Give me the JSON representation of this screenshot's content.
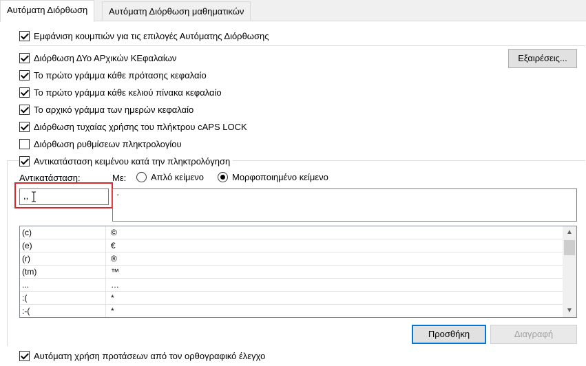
{
  "tabs": [
    {
      "label": "Αυτόματη Διόρθωση",
      "active": true
    },
    {
      "label": "Αυτόματη Διόρθωση μαθηματικών",
      "active": false
    }
  ],
  "options": {
    "show_buttons": {
      "label": "Εμφάνιση κουμπιών για τις επιλογές Αυτόματης Διόρθωσης",
      "checked": true
    },
    "two_initial_caps": {
      "label": "Διόρθωση ΔΥο ΑΡχικών ΚΕφαλαίων",
      "checked": true
    },
    "first_letter_sentence": {
      "label": "Το πρώτο γράμμα κάθε πρότασης κεφαλαίο",
      "checked": true
    },
    "first_letter_table_cell": {
      "label": "Το πρώτο γράμμα κάθε κελιού πίνακα κεφαλαίο",
      "checked": true
    },
    "day_names": {
      "label": "Το αρχικό γράμμα των ημερών κεφαλαίο",
      "checked": true
    },
    "caps_lock": {
      "label": "Διόρθωση τυχαίας χρήσης του πλήκτρου cAPS LOCK",
      "checked": true
    },
    "keyboard_settings": {
      "label": "Διόρθωση ρυθμίσεων πληκτρολογίου",
      "checked": false
    },
    "replace_text": {
      "label": "Αντικατάσταση κειμένου κατά την πληκτρολόγηση",
      "checked": true
    },
    "spellcheck_suggestions": {
      "label": "Αυτόματη χρήση προτάσεων από τον ορθογραφικό έλεγχο",
      "checked": true
    }
  },
  "buttons": {
    "exceptions": "Εξαιρέσεις...",
    "add": "Προσθήκη",
    "delete": "Διαγραφή"
  },
  "replace": {
    "replace_label": "Αντικατάσταση:",
    "with_label": "Με:",
    "plain_text": "Απλό κείμενο",
    "formatted_text": "Μορφοποιημένο κείμενο",
    "selected_format": "formatted",
    "replace_value": ",,",
    "with_value": "·"
  },
  "table": {
    "rows": [
      {
        "from": "(c)",
        "to": "©"
      },
      {
        "from": "(e)",
        "to": "€"
      },
      {
        "from": "(r)",
        "to": "®"
      },
      {
        "from": "(tm)",
        "to": "™"
      },
      {
        "from": "...",
        "to": "…"
      },
      {
        "from": ":(",
        "to": "*"
      },
      {
        "from": ":-(",
        "to": "*"
      }
    ]
  },
  "icons": {
    "scroll_up": "chevron-up-icon",
    "scroll_down": "chevron-down-icon",
    "cursor": "text-cursor-icon"
  },
  "colors": {
    "highlight_box": "#d9262d",
    "primary_button_border": "#0078d7"
  }
}
